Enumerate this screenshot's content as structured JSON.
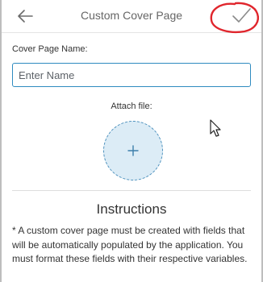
{
  "header": {
    "title": "Custom Cover Page",
    "back_icon": "arrow-left-icon",
    "confirm_icon": "checkmark-icon"
  },
  "form": {
    "name_label": "Cover Page Name:",
    "name_placeholder": "Enter Name",
    "name_value": "",
    "attach_label": "Attach file:",
    "attach_icon": "plus-icon"
  },
  "instructions": {
    "title": "Instructions",
    "text": "* A custom cover page must be created with fields that will be automatically populated by the application. You must format these fields with their respective variables."
  },
  "colors": {
    "accent": "#2f8bc0",
    "attach_fill": "#dcecf6",
    "annotation": "#e0262d"
  }
}
